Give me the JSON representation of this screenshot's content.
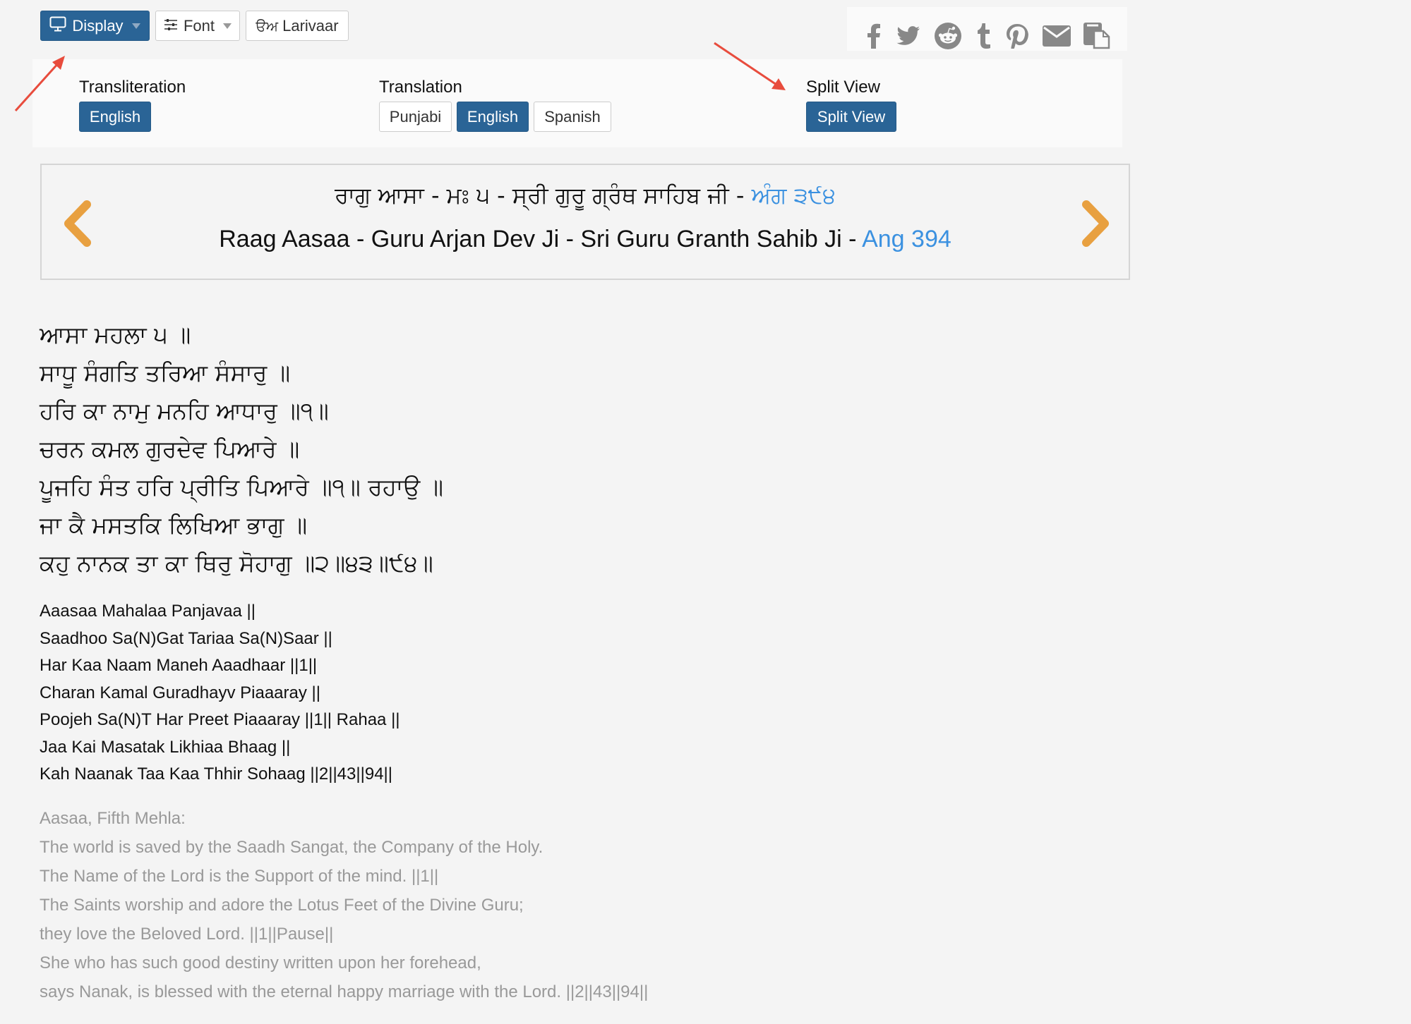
{
  "toolbar": {
    "display_label": "Display",
    "font_label": "Font",
    "larivaar_glyph": "ੳਅ",
    "larivaar_label": "Larivaar"
  },
  "social": {
    "icons": [
      "facebook-icon",
      "twitter-icon",
      "reddit-icon",
      "tumblr-icon",
      "pinterest-icon",
      "email-icon",
      "copy-icon"
    ]
  },
  "options": {
    "transliteration": {
      "label": "Transliteration",
      "buttons": [
        {
          "label": "English",
          "active": true
        }
      ]
    },
    "translation": {
      "label": "Translation",
      "buttons": [
        {
          "label": "Punjabi",
          "active": false
        },
        {
          "label": "English",
          "active": true
        },
        {
          "label": "Spanish",
          "active": false
        }
      ]
    },
    "split_view": {
      "label": "Split View",
      "button_label": "Split View",
      "active": true
    }
  },
  "header": {
    "gurmukhi_title": "ਰਾਗੁ ਆਸਾ - ਮਃ ੫ - ਸ੍ਰੀ ਗੁਰੂ ਗ੍ਰੰਥ ਸਾਹਿਬ ਜੀ - ",
    "gurmukhi_ang": "ਅੰਗ ੩੯੪",
    "english_title": "Raag Aasaa - Guru Arjan Dev Ji - Sri Guru Granth Sahib Ji - ",
    "english_ang": "Ang 394",
    "ang_color": "#3b91e0",
    "arrow_color": "#e8a040"
  },
  "gurbani": [
    "ਆਸਾ ਮਹਲਾ ੫ ॥",
    "ਸਾਧੂ ਸੰਗਤਿ ਤਰਿਆ ਸੰਸਾਰੁ ॥",
    "ਹਰਿ ਕਾ ਨਾਮੁ ਮਨਹਿ ਆਧਾਰੁ ॥੧॥",
    "ਚਰਨ ਕਮਲ ਗੁਰਦੇਵ ਪਿਆਰੇ ॥",
    "ਪੂਜਹਿ ਸੰਤ ਹਰਿ ਪ੍ਰੀਤਿ ਪਿਆਰੇ ॥੧॥ ਰਹਾਉ ॥",
    "ਜਾ ਕੈ ਮਸਤਕਿ ਲਿਖਿਆ ਭਾਗੁ ॥",
    "ਕਹੁ ਨਾਨਕ ਤਾ ਕਾ ਥਿਰੁ ਸੋਹਾਗੁ ॥੨॥੪੩॥੯੪॥"
  ],
  "transliteration": [
    "Aaasaa Mahalaa Panjavaa ||",
    "Saadhoo Sa(N)Gat Tariaa Sa(N)Saar ||",
    "Har Kaa Naam Maneh Aaadhaar ||1||",
    "Charan Kamal Guradhayv Piaaaray ||",
    "Poojeh Sa(N)T Har Preet Piaaaray ||1|| Rahaa ||",
    "Jaa Kai Masatak Likhiaa Bhaag ||",
    "Kah Naanak Taa Kaa Thhir Sohaag ||2||43||94||"
  ],
  "translation": [
    "Aasaa, Fifth Mehla:",
    "The world is saved by the Saadh Sangat, the Company of the Holy.",
    "The Name of the Lord is the Support of the mind. ||1||",
    "The Saints worship and adore the Lotus Feet of the Divine Guru;",
    "they love the Beloved Lord. ||1||Pause||",
    "She who has such good destiny written upon her forehead,",
    "says Nanak, is blessed with the eternal happy marriage with the Lord. ||2||43||94||"
  ],
  "annotations": {
    "arrow_color": "#e84c3d"
  }
}
